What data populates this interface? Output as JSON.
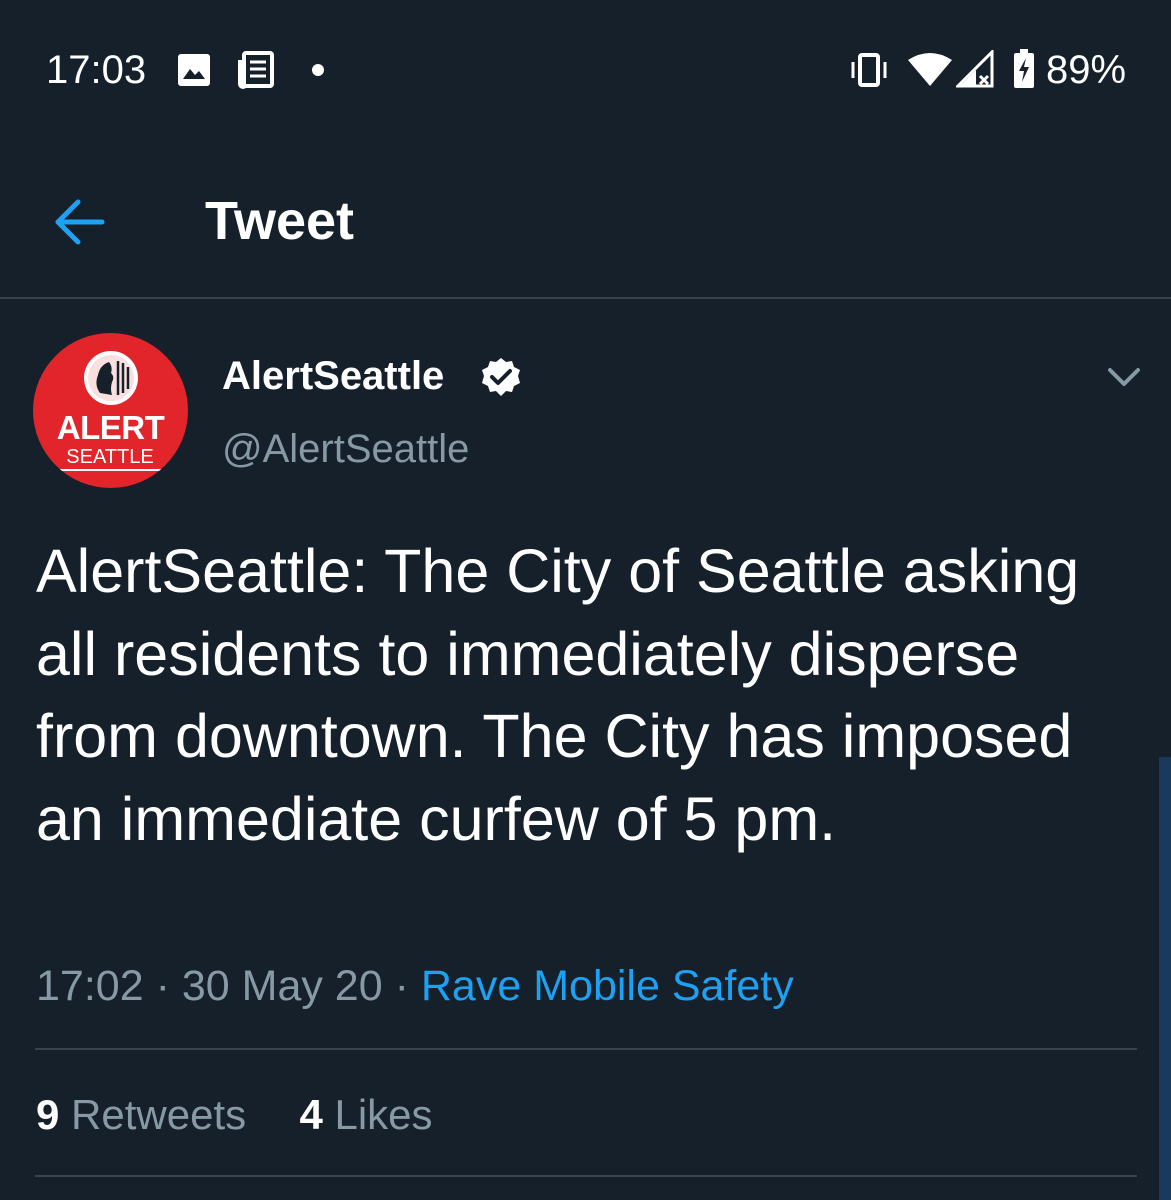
{
  "status_bar": {
    "time": "17:03",
    "battery": "89%",
    "icons": [
      "image-notification-icon",
      "news-notification-icon",
      "dot-icon",
      "vibrate-icon",
      "wifi-icon",
      "signal-icon",
      "battery-charging-icon"
    ]
  },
  "header": {
    "back_icon": "arrow-left-icon",
    "title": "Tweet"
  },
  "tweet": {
    "avatar": {
      "logo_text_1": "ALERT",
      "logo_text_2": "SEATTLE"
    },
    "display_name": "AlertSeattle",
    "verified": true,
    "handle": "@AlertSeattle",
    "text": "AlertSeattle: The City of Seattle asking all residents to immediately disperse from downtown. The City has imposed an immediate curfew of 5 pm.",
    "time": "17:02",
    "date": "30 May 20",
    "separator": "·",
    "source": "Rave Mobile Safety",
    "retweets_count": "9",
    "retweets_label": "Retweets",
    "likes_count": "4",
    "likes_label": "Likes"
  },
  "colors": {
    "background": "#15202b",
    "accent": "#1da1f2",
    "secondary_text": "#8899a6",
    "divider": "#38444d",
    "avatar_red": "#e2252b"
  }
}
